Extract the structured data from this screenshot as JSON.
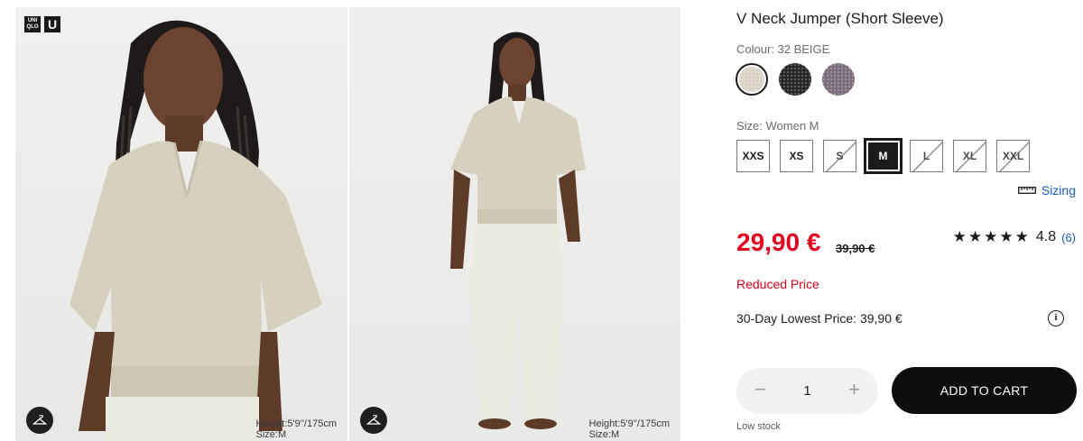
{
  "gallery": {
    "logo": {
      "top_left": [
        "UNI",
        "QLO"
      ],
      "top_right": "U"
    },
    "photos": [
      {
        "height_text": "Height:5'9''/175cm",
        "size_text": "Size:M"
      },
      {
        "height_text": "Height:5'9''/175cm",
        "size_text": "Size:M"
      }
    ]
  },
  "product": {
    "title": "V Neck Jumper (Short Sleeve)",
    "colour_label": "Colour: 32 BEIGE",
    "colours": [
      {
        "name": "beige",
        "hex": "#d9d3c4",
        "selected": true
      },
      {
        "name": "black",
        "hex": "#222424",
        "selected": false
      },
      {
        "name": "purple",
        "hex": "#7a6a78",
        "selected": false
      }
    ],
    "size_label": "Size: Women M",
    "sizes": [
      {
        "label": "XXS",
        "available": true,
        "selected": false
      },
      {
        "label": "XS",
        "available": true,
        "selected": false
      },
      {
        "label": "S",
        "available": false,
        "selected": false
      },
      {
        "label": "M",
        "available": true,
        "selected": true
      },
      {
        "label": "L",
        "available": false,
        "selected": false
      },
      {
        "label": "XL",
        "available": false,
        "selected": false
      },
      {
        "label": "XXL",
        "available": false,
        "selected": false
      }
    ],
    "sizing_link": "Sizing",
    "price": "29,90 €",
    "old_price": "39,90 €",
    "rating": {
      "stars": "★★★★★",
      "score": "4.8",
      "count": "(6)"
    },
    "reduced_text": "Reduced Price",
    "lowest_price_text": "30-Day Lowest Price: 39,90 €",
    "quantity": {
      "minus": "−",
      "value": "1",
      "plus": "+"
    },
    "add_to_cart": "ADD TO CART",
    "stock_text": "Low stock"
  },
  "colors": {
    "sale_red": "#e0001f",
    "link_blue": "#1b5fb4",
    "cta_black": "#0e0e0e"
  }
}
